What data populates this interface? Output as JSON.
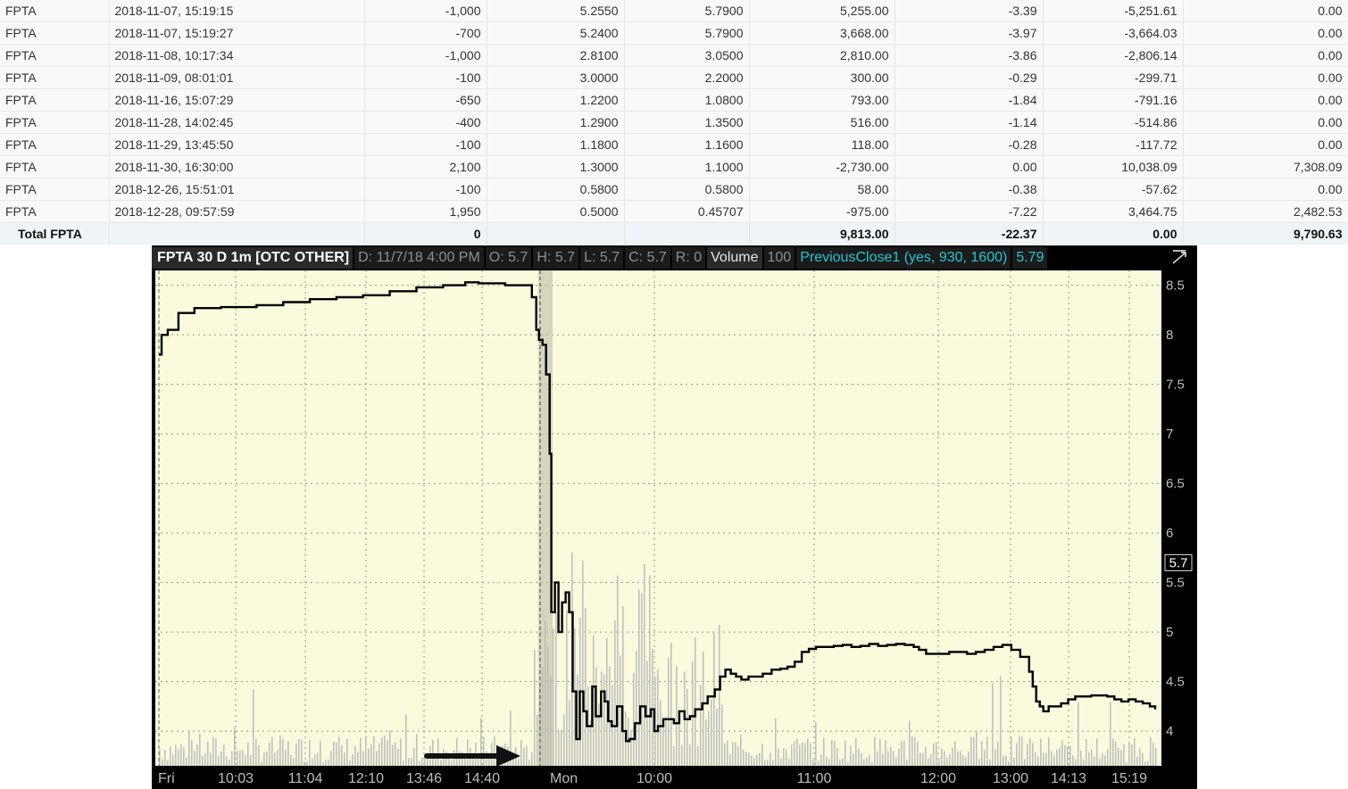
{
  "table": {
    "rows": [
      {
        "symbol": "FPTA",
        "datetime": "2018-11-07, 15:19:15",
        "qty": "-1,000",
        "price": "5.2550",
        "close": "5.7900",
        "proceeds": "5,255.00",
        "fee": "-3.39",
        "basis": "-5,251.61",
        "pnl": "0.00"
      },
      {
        "symbol": "FPTA",
        "datetime": "2018-11-07, 15:19:27",
        "qty": "-700",
        "price": "5.2400",
        "close": "5.7900",
        "proceeds": "3,668.00",
        "fee": "-3.97",
        "basis": "-3,664.03",
        "pnl": "0.00"
      },
      {
        "symbol": "FPTA",
        "datetime": "2018-11-08, 10:17:34",
        "qty": "-1,000",
        "price": "2.8100",
        "close": "3.0500",
        "proceeds": "2,810.00",
        "fee": "-3.86",
        "basis": "-2,806.14",
        "pnl": "0.00"
      },
      {
        "symbol": "FPTA",
        "datetime": "2018-11-09, 08:01:01",
        "qty": "-100",
        "price": "3.0000",
        "close": "2.2000",
        "proceeds": "300.00",
        "fee": "-0.29",
        "basis": "-299.71",
        "pnl": "0.00"
      },
      {
        "symbol": "FPTA",
        "datetime": "2018-11-16, 15:07:29",
        "qty": "-650",
        "price": "1.2200",
        "close": "1.0800",
        "proceeds": "793.00",
        "fee": "-1.84",
        "basis": "-791.16",
        "pnl": "0.00"
      },
      {
        "symbol": "FPTA",
        "datetime": "2018-11-28, 14:02:45",
        "qty": "-400",
        "price": "1.2900",
        "close": "1.3500",
        "proceeds": "516.00",
        "fee": "-1.14",
        "basis": "-514.86",
        "pnl": "0.00"
      },
      {
        "symbol": "FPTA",
        "datetime": "2018-11-29, 13:45:50",
        "qty": "-100",
        "price": "1.1800",
        "close": "1.1600",
        "proceeds": "118.00",
        "fee": "-0.28",
        "basis": "-117.72",
        "pnl": "0.00"
      },
      {
        "symbol": "FPTA",
        "datetime": "2018-11-30, 16:30:00",
        "qty": "2,100",
        "price": "1.3000",
        "close": "1.1000",
        "proceeds": "-2,730.00",
        "fee": "0.00",
        "basis": "10,038.09",
        "pnl": "7,308.09"
      },
      {
        "symbol": "FPTA",
        "datetime": "2018-12-26, 15:51:01",
        "qty": "-100",
        "price": "0.5800",
        "close": "0.5800",
        "proceeds": "58.00",
        "fee": "-0.38",
        "basis": "-57.62",
        "pnl": "0.00"
      },
      {
        "symbol": "FPTA",
        "datetime": "2018-12-28, 09:57:59",
        "qty": "1,950",
        "price": "0.5000",
        "close": "0.45707",
        "proceeds": "-975.00",
        "fee": "-7.22",
        "basis": "3,464.75",
        "pnl": "2,482.53"
      }
    ],
    "total": {
      "label": "Total FPTA",
      "qty": "0",
      "proceeds": "9,813.00",
      "fee": "-22.37",
      "basis": "0.00",
      "pnl": "9,790.63"
    }
  },
  "chart": {
    "title": "FPTA 30 D 1m [OTC OTHER]",
    "date_info": "D: 11/7/18 4:00 PM",
    "open": "O: 5.7",
    "high": "H: 5.7",
    "low": "L: 5.7",
    "close": "C: 5.7",
    "range": "R: 0",
    "volume_label": "Volume",
    "volume_value": "100",
    "study_label": "PreviousClose1 (yes, 930, 1600)",
    "study_value": "5.79",
    "corner_icon": "chart-settings-icon",
    "last_price": "5.7",
    "colors": {
      "background": "#fafadc",
      "price_line": "#000000",
      "volume": "#c0c0c0",
      "study": "#1fc7d4",
      "session_divider": "#b8b8a6"
    }
  },
  "chart_data": {
    "type": "line",
    "ylim": [
      3.65,
      8.65
    ],
    "yticks": [
      "8.5",
      "8",
      "7.5",
      "7",
      "6.5",
      "6",
      "5.5",
      "5",
      "4.5",
      "4"
    ],
    "xticks": [
      "Fri",
      "10:03",
      "11:04",
      "12:10",
      "13:46",
      "14:40",
      "Mon",
      "10:00",
      "11:00",
      "12:00",
      "13:00",
      "14:13",
      "15:19"
    ],
    "series": [
      {
        "values": [
          [
            0,
            7.8
          ],
          [
            3,
            8.0
          ],
          [
            10,
            8.05
          ],
          [
            22,
            8.22
          ],
          [
            40,
            8.27
          ],
          [
            70,
            8.28
          ],
          [
            110,
            8.3
          ],
          [
            140,
            8.33
          ],
          [
            170,
            8.36
          ],
          [
            200,
            8.38
          ],
          [
            230,
            8.4
          ],
          [
            260,
            8.44
          ],
          [
            290,
            8.48
          ],
          [
            320,
            8.5
          ],
          [
            345,
            8.53
          ],
          [
            360,
            8.52
          ],
          [
            390,
            8.5
          ],
          [
            410,
            8.5
          ],
          [
            420,
            8.38
          ],
          [
            425,
            8.05
          ],
          [
            428,
            7.95
          ],
          [
            432,
            7.9
          ],
          [
            436,
            7.6
          ],
          [
            440,
            6.8
          ],
          [
            442,
            5.2
          ],
          [
            446,
            5.5
          ],
          [
            450,
            5.0
          ],
          [
            454,
            5.3
          ],
          [
            458,
            5.4
          ],
          [
            462,
            5.2
          ],
          [
            466,
            4.4
          ],
          [
            470,
            3.92
          ],
          [
            474,
            4.4
          ],
          [
            478,
            4.2
          ],
          [
            482,
            4.05
          ],
          [
            488,
            4.45
          ],
          [
            492,
            4.15
          ],
          [
            498,
            4.4
          ],
          [
            502,
            4.3
          ],
          [
            506,
            4.1
          ],
          [
            510,
            4.05
          ],
          [
            516,
            4.25
          ],
          [
            522,
            4.0
          ],
          [
            526,
            3.9
          ],
          [
            530,
            3.92
          ],
          [
            536,
            4.08
          ],
          [
            542,
            4.25
          ],
          [
            548,
            4.15
          ],
          [
            554,
            4.22
          ],
          [
            558,
            4.0
          ],
          [
            562,
            4.05
          ],
          [
            568,
            4.12
          ],
          [
            574,
            4.12
          ],
          [
            580,
            4.08
          ],
          [
            586,
            4.2
          ],
          [
            592,
            4.12
          ],
          [
            598,
            4.15
          ],
          [
            604,
            4.22
          ],
          [
            612,
            4.28
          ],
          [
            618,
            4.35
          ],
          [
            626,
            4.42
          ],
          [
            632,
            4.55
          ],
          [
            638,
            4.62
          ],
          [
            644,
            4.58
          ],
          [
            650,
            4.55
          ],
          [
            656,
            4.52
          ],
          [
            664,
            4.55
          ],
          [
            672,
            4.55
          ],
          [
            680,
            4.58
          ],
          [
            690,
            4.62
          ],
          [
            700,
            4.63
          ],
          [
            708,
            4.65
          ],
          [
            716,
            4.7
          ],
          [
            724,
            4.8
          ],
          [
            732,
            4.83
          ],
          [
            740,
            4.85
          ],
          [
            750,
            4.85
          ],
          [
            760,
            4.86
          ],
          [
            770,
            4.87
          ],
          [
            780,
            4.85
          ],
          [
            790,
            4.86
          ],
          [
            800,
            4.88
          ],
          [
            810,
            4.86
          ],
          [
            820,
            4.87
          ],
          [
            830,
            4.88
          ],
          [
            840,
            4.87
          ],
          [
            850,
            4.85
          ],
          [
            856,
            4.82
          ],
          [
            864,
            4.78
          ],
          [
            872,
            4.78
          ],
          [
            880,
            4.78
          ],
          [
            890,
            4.8
          ],
          [
            900,
            4.8
          ],
          [
            910,
            4.78
          ],
          [
            920,
            4.8
          ],
          [
            930,
            4.82
          ],
          [
            940,
            4.85
          ],
          [
            950,
            4.87
          ],
          [
            960,
            4.82
          ],
          [
            970,
            4.75
          ],
          [
            980,
            4.6
          ],
          [
            984,
            4.45
          ],
          [
            988,
            4.3
          ],
          [
            992,
            4.25
          ],
          [
            996,
            4.2
          ],
          [
            1002,
            4.25
          ],
          [
            1008,
            4.25
          ],
          [
            1016,
            4.28
          ],
          [
            1024,
            4.32
          ],
          [
            1032,
            4.35
          ],
          [
            1040,
            4.35
          ],
          [
            1050,
            4.36
          ],
          [
            1060,
            4.36
          ],
          [
            1068,
            4.35
          ],
          [
            1076,
            4.32
          ],
          [
            1084,
            4.3
          ],
          [
            1092,
            4.32
          ],
          [
            1100,
            4.3
          ],
          [
            1108,
            4.28
          ],
          [
            1116,
            4.25
          ],
          [
            1122,
            4.22
          ]
        ]
      }
    ]
  }
}
